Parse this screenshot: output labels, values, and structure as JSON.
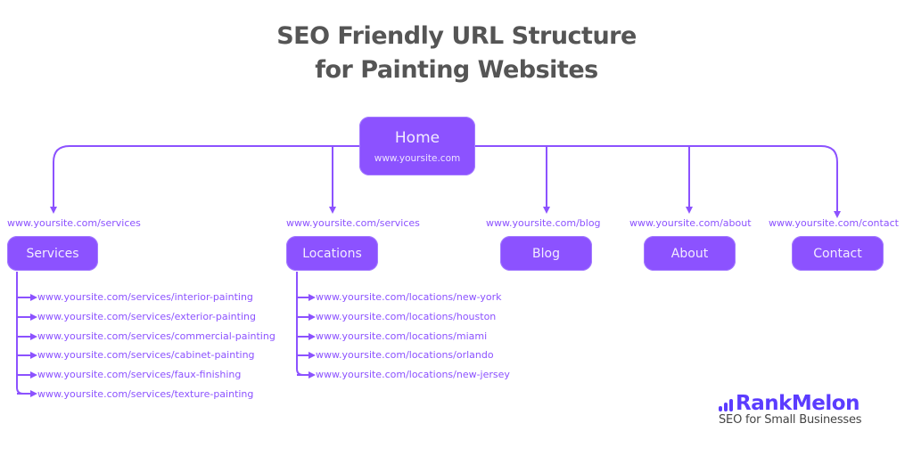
{
  "title": {
    "line1": "SEO Friendly URL Structure",
    "line2": "for Painting Websites"
  },
  "colors": {
    "accent": "#8c52ff",
    "title_text": "#555555",
    "brand": "#5b3cff"
  },
  "home": {
    "label": "Home",
    "url": "www.yoursite.com"
  },
  "sections": [
    {
      "label": "Services",
      "url": "www.yoursite.com/services",
      "children": [
        "www.yoursite.com/services/interior-painting",
        "www.yoursite.com/services/exterior-painting",
        "www.yoursite.com/services/commercial-painting",
        "www.yoursite.com/services/cabinet-painting",
        "www.yoursite.com/services/faux-finishing",
        "www.yoursite.com/services/texture-painting"
      ]
    },
    {
      "label": "Locations",
      "url": "www.yoursite.com/services",
      "children": [
        "www.yoursite.com/locations/new-york",
        "www.yoursite.com/locations/houston",
        "www.yoursite.com/locations/miami",
        "www.yoursite.com/locations/orlando",
        "www.yoursite.com/locations/new-jersey"
      ]
    },
    {
      "label": "Blog",
      "url": "www.yoursite.com/blog",
      "children": []
    },
    {
      "label": "About",
      "url": "www.yoursite.com/about",
      "children": []
    },
    {
      "label": "Contact",
      "url": "www.yoursite.com/contact",
      "children": []
    }
  ],
  "brand": {
    "icon": "bar-chart-icon",
    "name": "RankMelon",
    "tagline": "SEO for Small Businesses"
  }
}
